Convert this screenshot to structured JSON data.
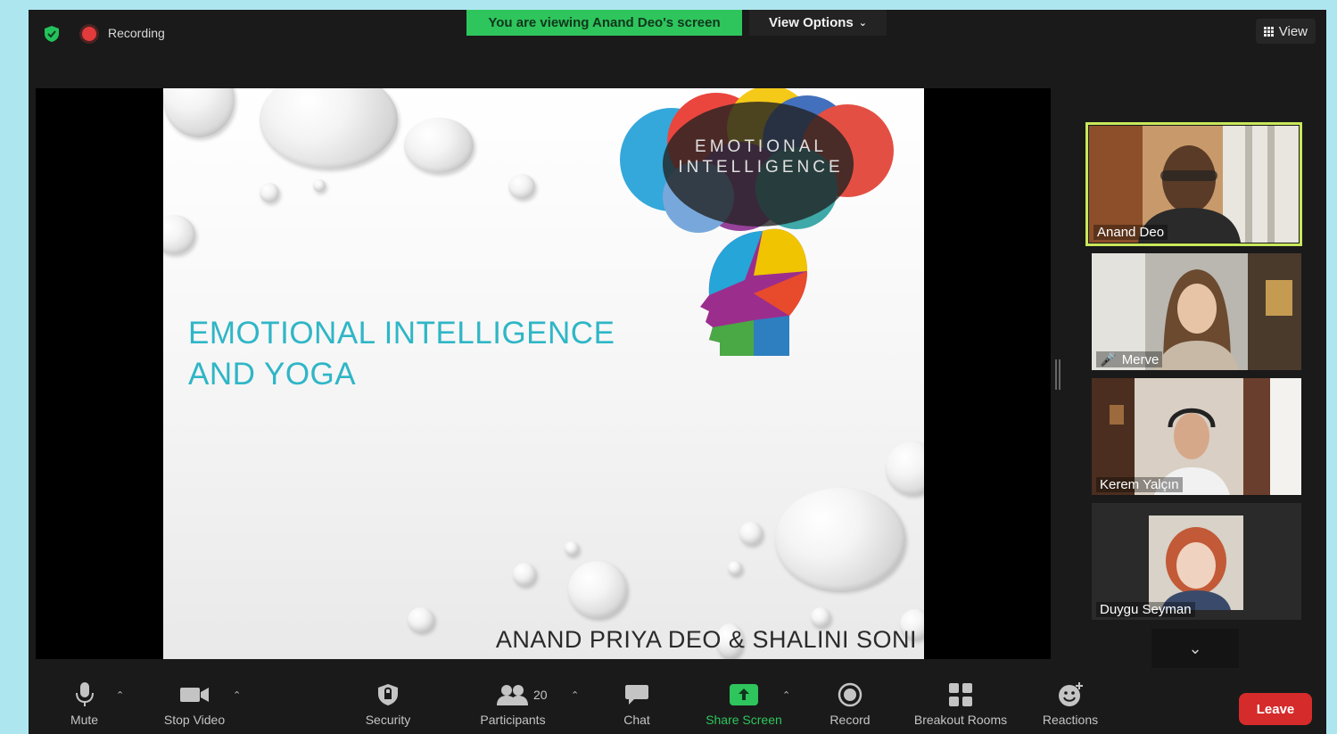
{
  "top_bar": {
    "recording_label": "Recording",
    "viewing_banner": "You are viewing Anand Deo's screen",
    "view_options_label": "View Options",
    "view_button_label": "View"
  },
  "slide": {
    "title_line1": "EMOTIONAL INTELLIGENCE",
    "title_line2": "AND YOGA",
    "art_caption_line1": "EMOTIONAL",
    "art_caption_line2": "INTELLIGENCE",
    "authors": "ANAND PRIYA DEO & SHALINI SONI"
  },
  "participants": [
    {
      "name": "Anand Deo",
      "active_speaker": true,
      "muted": false
    },
    {
      "name": "Merve",
      "active_speaker": false,
      "muted": true
    },
    {
      "name": "Kerem Yalçın",
      "active_speaker": false,
      "muted": false
    },
    {
      "name": "Duygu Seyman",
      "active_speaker": false,
      "muted": false
    }
  ],
  "toolbar": {
    "mute_label": "Mute",
    "stop_video_label": "Stop Video",
    "security_label": "Security",
    "participants_label": "Participants",
    "participants_count": "20",
    "chat_label": "Chat",
    "share_screen_label": "Share Screen",
    "record_label": "Record",
    "breakout_label": "Breakout Rooms",
    "reactions_label": "Reactions",
    "leave_label": "Leave"
  },
  "colors": {
    "accent_green": "#2ec55c",
    "recording_red": "#e23b3b",
    "leave_red": "#d52b2b",
    "active_speaker_outline": "#c9e85a",
    "slide_title_teal": "#2fb6c6"
  }
}
